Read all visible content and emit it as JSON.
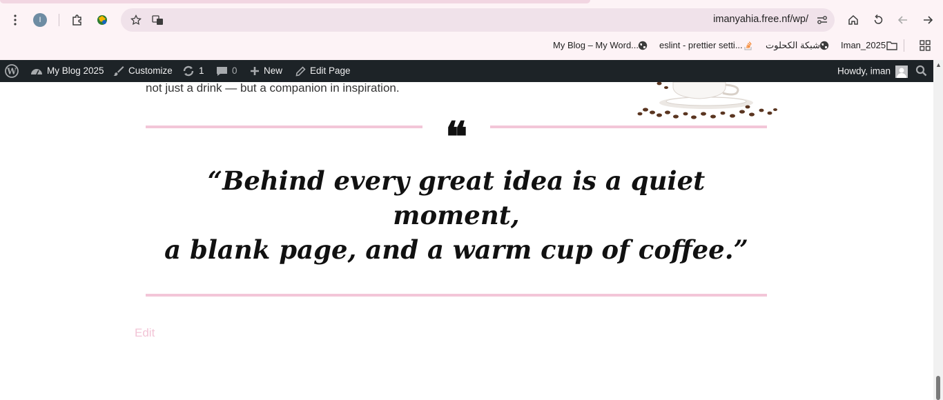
{
  "browser": {
    "url": "imanyahia.free.nf/wp/",
    "profile_initial": "I",
    "bookmarks": [
      {
        "label": "Iman_2025"
      },
      {
        "label": "شبكة الكحلوت"
      },
      {
        "label": "eslint - prettier setti..."
      },
      {
        "label": "My Blog – My Word..."
      }
    ]
  },
  "admin_bar": {
    "site_name": "My Blog 2025",
    "customize": "Customize",
    "updates_count": "1",
    "comments_count": "0",
    "new_label": "New",
    "edit_page": "Edit Page",
    "howdy": "Howdy, iman"
  },
  "content": {
    "intro_text": "not just a drink — but a companion in inspiration.",
    "quote_mark": "❝",
    "quote_line1": "“Behind every great idea is a quiet moment,",
    "quote_line2": "a blank page, and a warm cup of coffee.”",
    "edit_link": "Edit"
  },
  "colors": {
    "accent_pink": "#f3c6d8",
    "admin_bar_bg": "#1d2327",
    "chrome_bg": "#fdf3f6"
  }
}
